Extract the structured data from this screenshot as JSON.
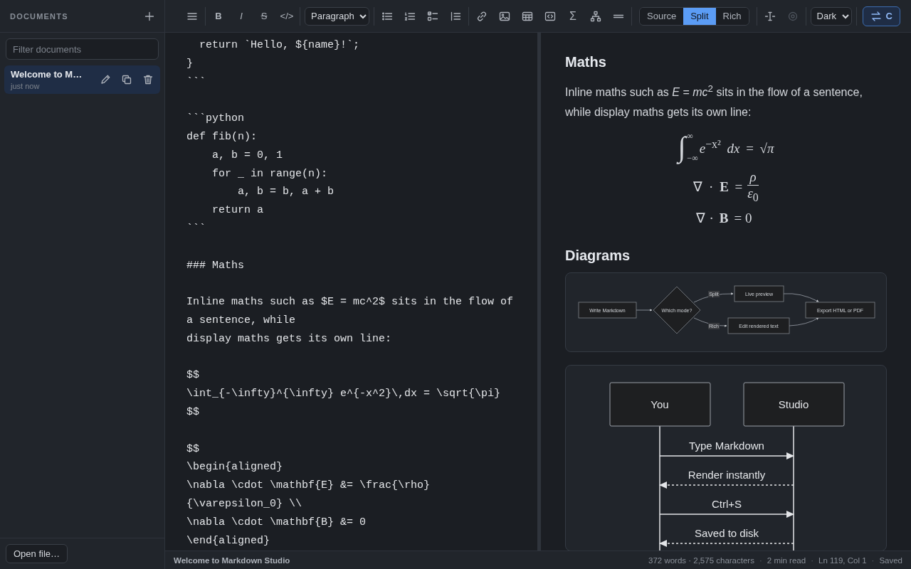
{
  "sidebar": {
    "title": "DOCUMENTS",
    "filter": {
      "placeholder": "Filter documents"
    },
    "documents": [
      {
        "title": "Welcome to M…",
        "time": "just now",
        "selected": true
      }
    ],
    "open_button": "Open file…"
  },
  "toolbar": {
    "groups": [
      [
        {
          "kind": "icon",
          "disabled": false
        }
      ],
      [
        {
          "kind": "text",
          "label": "B"
        },
        {
          "kind": "text",
          "label": "I"
        },
        {
          "kind": "text",
          "label": "S"
        },
        {
          "kind": "text",
          "label": "</>"
        }
      ],
      [
        {
          "kind": "select",
          "value": "Paragraph"
        }
      ],
      [
        {
          "kind": "icon",
          "disabled": false
        },
        {
          "kind": "icon",
          "disabled": false
        },
        {
          "kind": "icon",
          "disabled": false
        },
        {
          "kind": "icon",
          "disabled": false
        }
      ],
      [
        {
          "kind": "icon",
          "disabled": false
        },
        {
          "kind": "icon",
          "disabled": false
        },
        {
          "kind": "icon",
          "disabled": false
        },
        {
          "kind": "icon",
          "disabled": false
        },
        {
          "kind": "text",
          "label": "Σ"
        },
        {
          "kind": "icon",
          "disabled": false
        },
        {
          "kind": "icon",
          "disabled": false
        }
      ],
      [
        {
          "kind": "segmented",
          "options": [
            {
              "label": "Source",
              "selected": false
            },
            {
              "label": "Split",
              "selected": true
            },
            {
              "label": "Rich",
              "selected": false
            }
          ]
        }
      ],
      [
        {
          "kind": "icon",
          "disabled": false
        },
        {
          "kind": "icon",
          "disabled": true
        }
      ],
      [
        {
          "kind": "select",
          "value": "Dark"
        }
      ],
      [
        {
          "kind": "button",
          "label": "C"
        }
      ]
    ]
  },
  "editor": {
    "blocks": [
      [
        "  return `Hello, ${name}!`;",
        "}",
        "```"
      ],
      [
        "```python",
        "def fib(n):",
        "    a, b = 0, 1",
        "    for _ in range(n):",
        "        a, b = b, a + b",
        "    return a",
        "```"
      ],
      [
        "### Maths"
      ],
      [
        "Inline maths such as $E = mc^2$ sits in the flow of",
        "a sentence, while",
        "display maths gets its own line:"
      ],
      [
        "$$",
        "\\int_{-\\infty}^{\\infty} e^{-x^2}\\,dx = \\sqrt{\\pi}",
        "$$"
      ],
      [
        "$$",
        "\\begin{aligned}",
        "\\nabla \\cdot \\mathbf{E} &= \\frac{\\rho}",
        "{\\varepsilon_0} \\\\",
        "\\nabla \\cdot \\mathbf{B} &= 0",
        "\\end{aligned}"
      ]
    ]
  },
  "preview": {
    "sections": [
      {
        "heading": "Maths",
        "paragraph": "Inline maths such as *E* = *mc*$^{2}$ sits in the flow of a sentence, while display maths gets its own line:",
        "equations": [
          {
            "kind": "integral",
            "symbol": "∫",
            "lower": "−∞",
            "upper": "∞",
            "body": "*e*$^{−x²}$ *dx* = √*π*"
          },
          {
            "kind": "fraction",
            "lhs": "∇ · **E** =",
            "numerator": "*ρ*",
            "denominator": "*ε*$_{0}$"
          },
          {
            "kind": "plain",
            "text": "∇·**B**=0"
          }
        ]
      },
      {
        "heading": "Diagrams",
        "flowchart": {
          "nodes": [
            {
              "label": "Write Markdown",
              "kind": "process"
            },
            {
              "label": "Which mode?",
              "kind": "decision"
            },
            {
              "label": "Live preview",
              "kind": "process"
            },
            {
              "label": "Edit rendered text",
              "kind": "process"
            },
            {
              "label": "Export HTML or PDF",
              "kind": "process"
            }
          ],
          "edge_labels": [
            "Split",
            "Rich"
          ]
        },
        "sequence": {
          "participants": [
            "You",
            "Studio"
          ],
          "messages": [
            {
              "text": "Type Markdown",
              "kind": "request"
            },
            {
              "text": "Render instantly",
              "kind": "reply"
            },
            {
              "text": "Ctrl+S",
              "kind": "request"
            },
            {
              "text": "Saved to disk",
              "kind": "reply"
            }
          ]
        }
      }
    ]
  },
  "status_bar": {
    "document": "Welcome to Markdown Studio",
    "separator": "·",
    "items": [
      "372 words · 2,575 characters",
      "2 min read",
      "Ln 119, Col 1",
      "Saved"
    ]
  }
}
